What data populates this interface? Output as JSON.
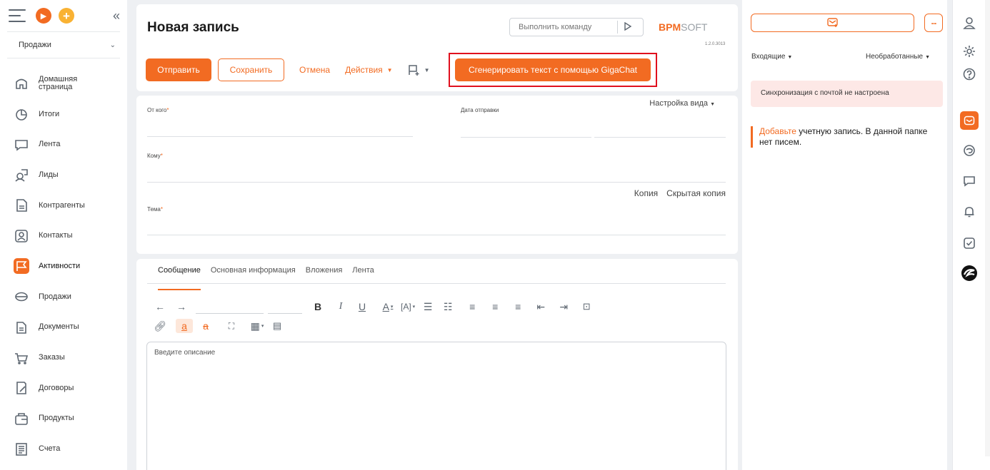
{
  "sidebar": {
    "workspace": "Продажи",
    "items": [
      {
        "label": "Домашняя\nстраница",
        "icon": "home-icon"
      },
      {
        "label": "Итоги",
        "icon": "chart-icon"
      },
      {
        "label": "Лента",
        "icon": "feed-icon"
      },
      {
        "label": "Лиды",
        "icon": "leads-icon"
      },
      {
        "label": "Контрагенты",
        "icon": "accounts-icon"
      },
      {
        "label": "Контакты",
        "icon": "contacts-icon"
      },
      {
        "label": "Активности",
        "icon": "flag-icon"
      },
      {
        "label": "Продажи",
        "icon": "opportunities-icon"
      },
      {
        "label": "Документы",
        "icon": "documents-icon"
      },
      {
        "label": "Заказы",
        "icon": "cart-icon"
      },
      {
        "label": "Договоры",
        "icon": "contracts-icon"
      },
      {
        "label": "Продукты",
        "icon": "products-icon"
      },
      {
        "label": "Счета",
        "icon": "invoices-icon"
      }
    ]
  },
  "header": {
    "title": "Новая запись",
    "command_placeholder": "Выполнить команду",
    "logo_part1": "BPM",
    "logo_part2": "SOFT",
    "version": "1.2.0.3013"
  },
  "toolbar": {
    "send": "Отправить",
    "save": "Сохранить",
    "cancel": "Отмена",
    "actions": "Действия",
    "gigachat": "Сгенерировать текст с помощью GigaChat"
  },
  "form": {
    "view_settings": "Настройка вида",
    "from_label": "От кого",
    "send_date_label": "Дата отправки",
    "to_label": "Кому",
    "subject_label": "Тема",
    "copy": "Копия",
    "bcc": "Скрытая копия"
  },
  "editor": {
    "tabs": [
      "Сообщение",
      "Основная информация",
      "Вложения",
      "Лента"
    ],
    "description_placeholder": "Введите описание"
  },
  "right_panel": {
    "filter_folder": "Входящие",
    "filter_status": "Необработанные",
    "alert": "Синхронизация с почтой не настроена",
    "msg_link": "Добавьте",
    "msg_text": " учетную запись. В данной папке нет писем."
  },
  "colors": {
    "accent": "#f26b22",
    "highlight_border": "#e0101e",
    "alert_bg": "#fde8e6"
  }
}
